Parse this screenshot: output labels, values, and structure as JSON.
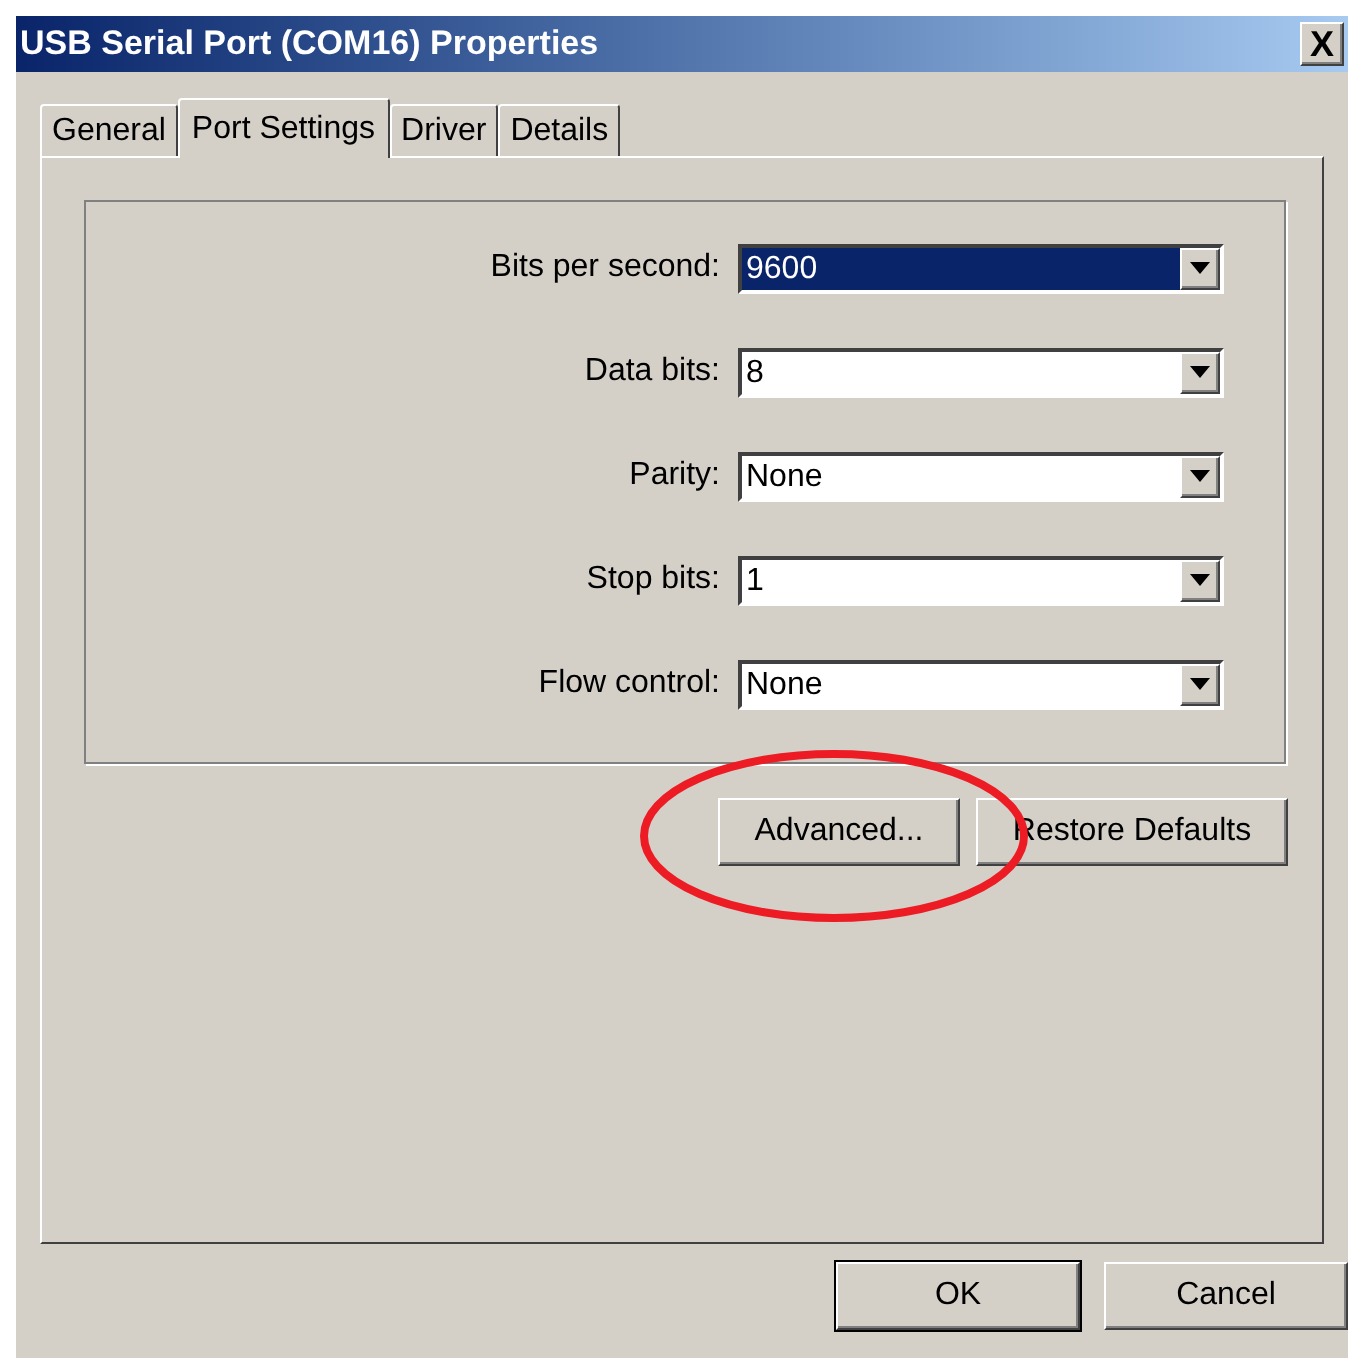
{
  "window": {
    "title": "USB Serial Port (COM16) Properties",
    "close": "X"
  },
  "tabs": [
    {
      "label": "General",
      "selected": false
    },
    {
      "label": "Port Settings",
      "selected": true
    },
    {
      "label": "Driver",
      "selected": false
    },
    {
      "label": "Details",
      "selected": false
    }
  ],
  "settings": [
    {
      "label": "Bits per second:",
      "value": "9600",
      "highlighted": true
    },
    {
      "label": "Data bits:",
      "value": "8",
      "highlighted": false
    },
    {
      "label": "Parity:",
      "value": "None",
      "highlighted": false
    },
    {
      "label": "Stop bits:",
      "value": "1",
      "highlighted": false
    },
    {
      "label": "Flow control:",
      "value": "None",
      "highlighted": false
    }
  ],
  "panel_buttons": [
    "Advanced...",
    "Restore Defaults"
  ],
  "dialog_buttons": [
    "OK",
    "Cancel"
  ]
}
